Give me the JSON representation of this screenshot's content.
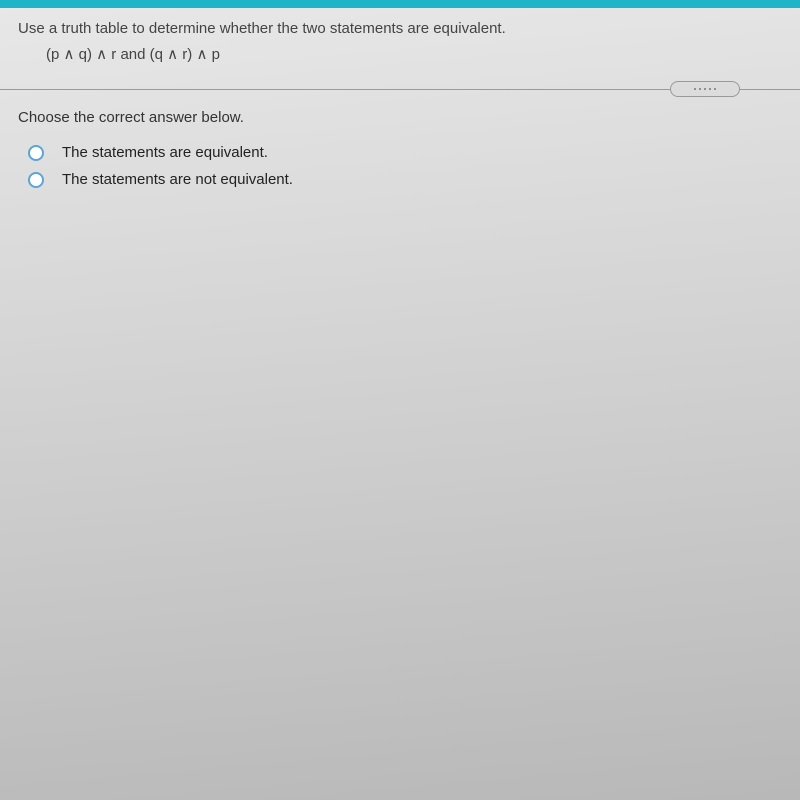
{
  "question": {
    "instruction": "Use a truth table to determine whether the two statements are equivalent.",
    "statements": "(p ∧ q) ∧ r and (q ∧ r) ∧ p"
  },
  "prompt": "Choose the correct answer below.",
  "options": [
    {
      "label": "The statements are equivalent."
    },
    {
      "label": "The statements are not equivalent."
    }
  ]
}
